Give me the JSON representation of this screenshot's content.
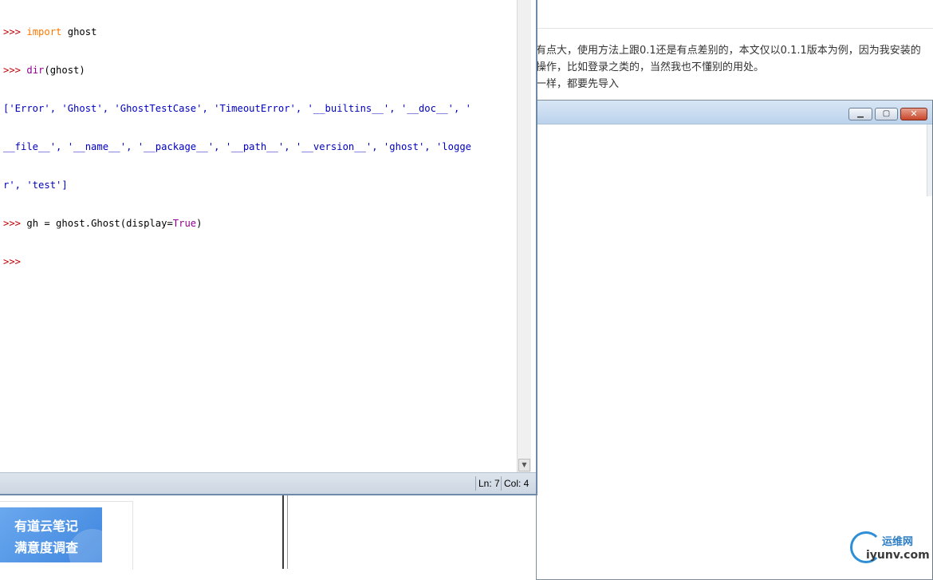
{
  "article": {
    "line1": "有点大，使用方法上跟0.1还是有点差别的，本文仅以0.1.1版本为例，因为我安装的",
    "line2": "操作，比如登录之类的，当然我也不懂别的用处。",
    "line3": "一样，都要先导入"
  },
  "shell": {
    "lines": [
      {
        "prompt": ">>> ",
        "keyword": "import",
        "rest": " ghost"
      },
      {
        "prompt": ">>> ",
        "builtin": "dir",
        "rest": "(ghost)"
      },
      {
        "output": "['Error', 'Ghost', 'GhostTestCase', 'TimeoutError', '__builtins__', '__doc__', '"
      },
      {
        "output": "__file__', '__name__', '__package__', '__path__', '__version__', 'ghost', 'logge"
      },
      {
        "output": "r', 'test']"
      },
      {
        "prompt": ">>> ",
        "code1": "gh = ghost.Ghost(display=",
        "builtin2": "True",
        "code2": ")"
      },
      {
        "prompt": ">>> "
      }
    ],
    "status_ln": "Ln: 7",
    "status_col": "Col: 4"
  },
  "window_controls": {
    "minimize_icon": "minimize-icon",
    "maximize_icon": "restore-icon",
    "close_icon": "close-icon"
  },
  "banner": {
    "line1": "有道云笔记",
    "line2": "满意度调查"
  },
  "watermark": {
    "cn": "运维网",
    "url": "iyunv.com"
  }
}
